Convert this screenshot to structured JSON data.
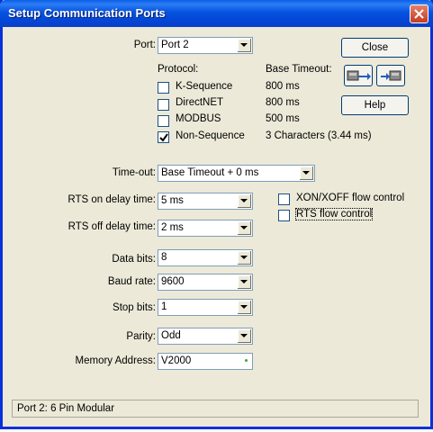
{
  "window": {
    "title": "Setup Communication Ports"
  },
  "port": {
    "label": "Port:",
    "value": "Port 2"
  },
  "protocol": {
    "header": "Protocol:",
    "timeout_header": "Base Timeout:",
    "items": [
      {
        "label": "K-Sequence",
        "timeout": "800 ms",
        "checked": false
      },
      {
        "label": "DirectNET",
        "timeout": "800 ms",
        "checked": false
      },
      {
        "label": "MODBUS",
        "timeout": "500 ms",
        "checked": false
      },
      {
        "label": "Non-Sequence",
        "timeout": "3 Characters (3.44 ms)",
        "checked": true
      }
    ]
  },
  "buttons": {
    "close": "Close",
    "help": "Help"
  },
  "icons": {
    "left": "upload-to-plc-icon",
    "right": "download-from-plc-icon"
  },
  "timeout": {
    "label": "Time-out:",
    "value": "Base Timeout + 0 ms"
  },
  "rts_on": {
    "label": "RTS on delay time:",
    "value": "5 ms"
  },
  "rts_off": {
    "label": "RTS off delay time:",
    "value": "2 ms"
  },
  "flow": {
    "xon": "XON/XOFF flow control",
    "rts": "RTS flow control"
  },
  "data_bits": {
    "label": "Data bits:",
    "value": "8"
  },
  "baud": {
    "label": "Baud rate:",
    "value": "9600"
  },
  "stop_bits": {
    "label": "Stop bits:",
    "value": "1"
  },
  "parity": {
    "label": "Parity:",
    "value": "Odd"
  },
  "memory": {
    "label": "Memory Address:",
    "value": "V2000"
  },
  "status": {
    "text": "Port 2: 6 Pin Modular"
  },
  "colors": {
    "title_bar": "#0553e0",
    "dialog_bg": "#ece9d8",
    "close_red": "#c23c20"
  }
}
